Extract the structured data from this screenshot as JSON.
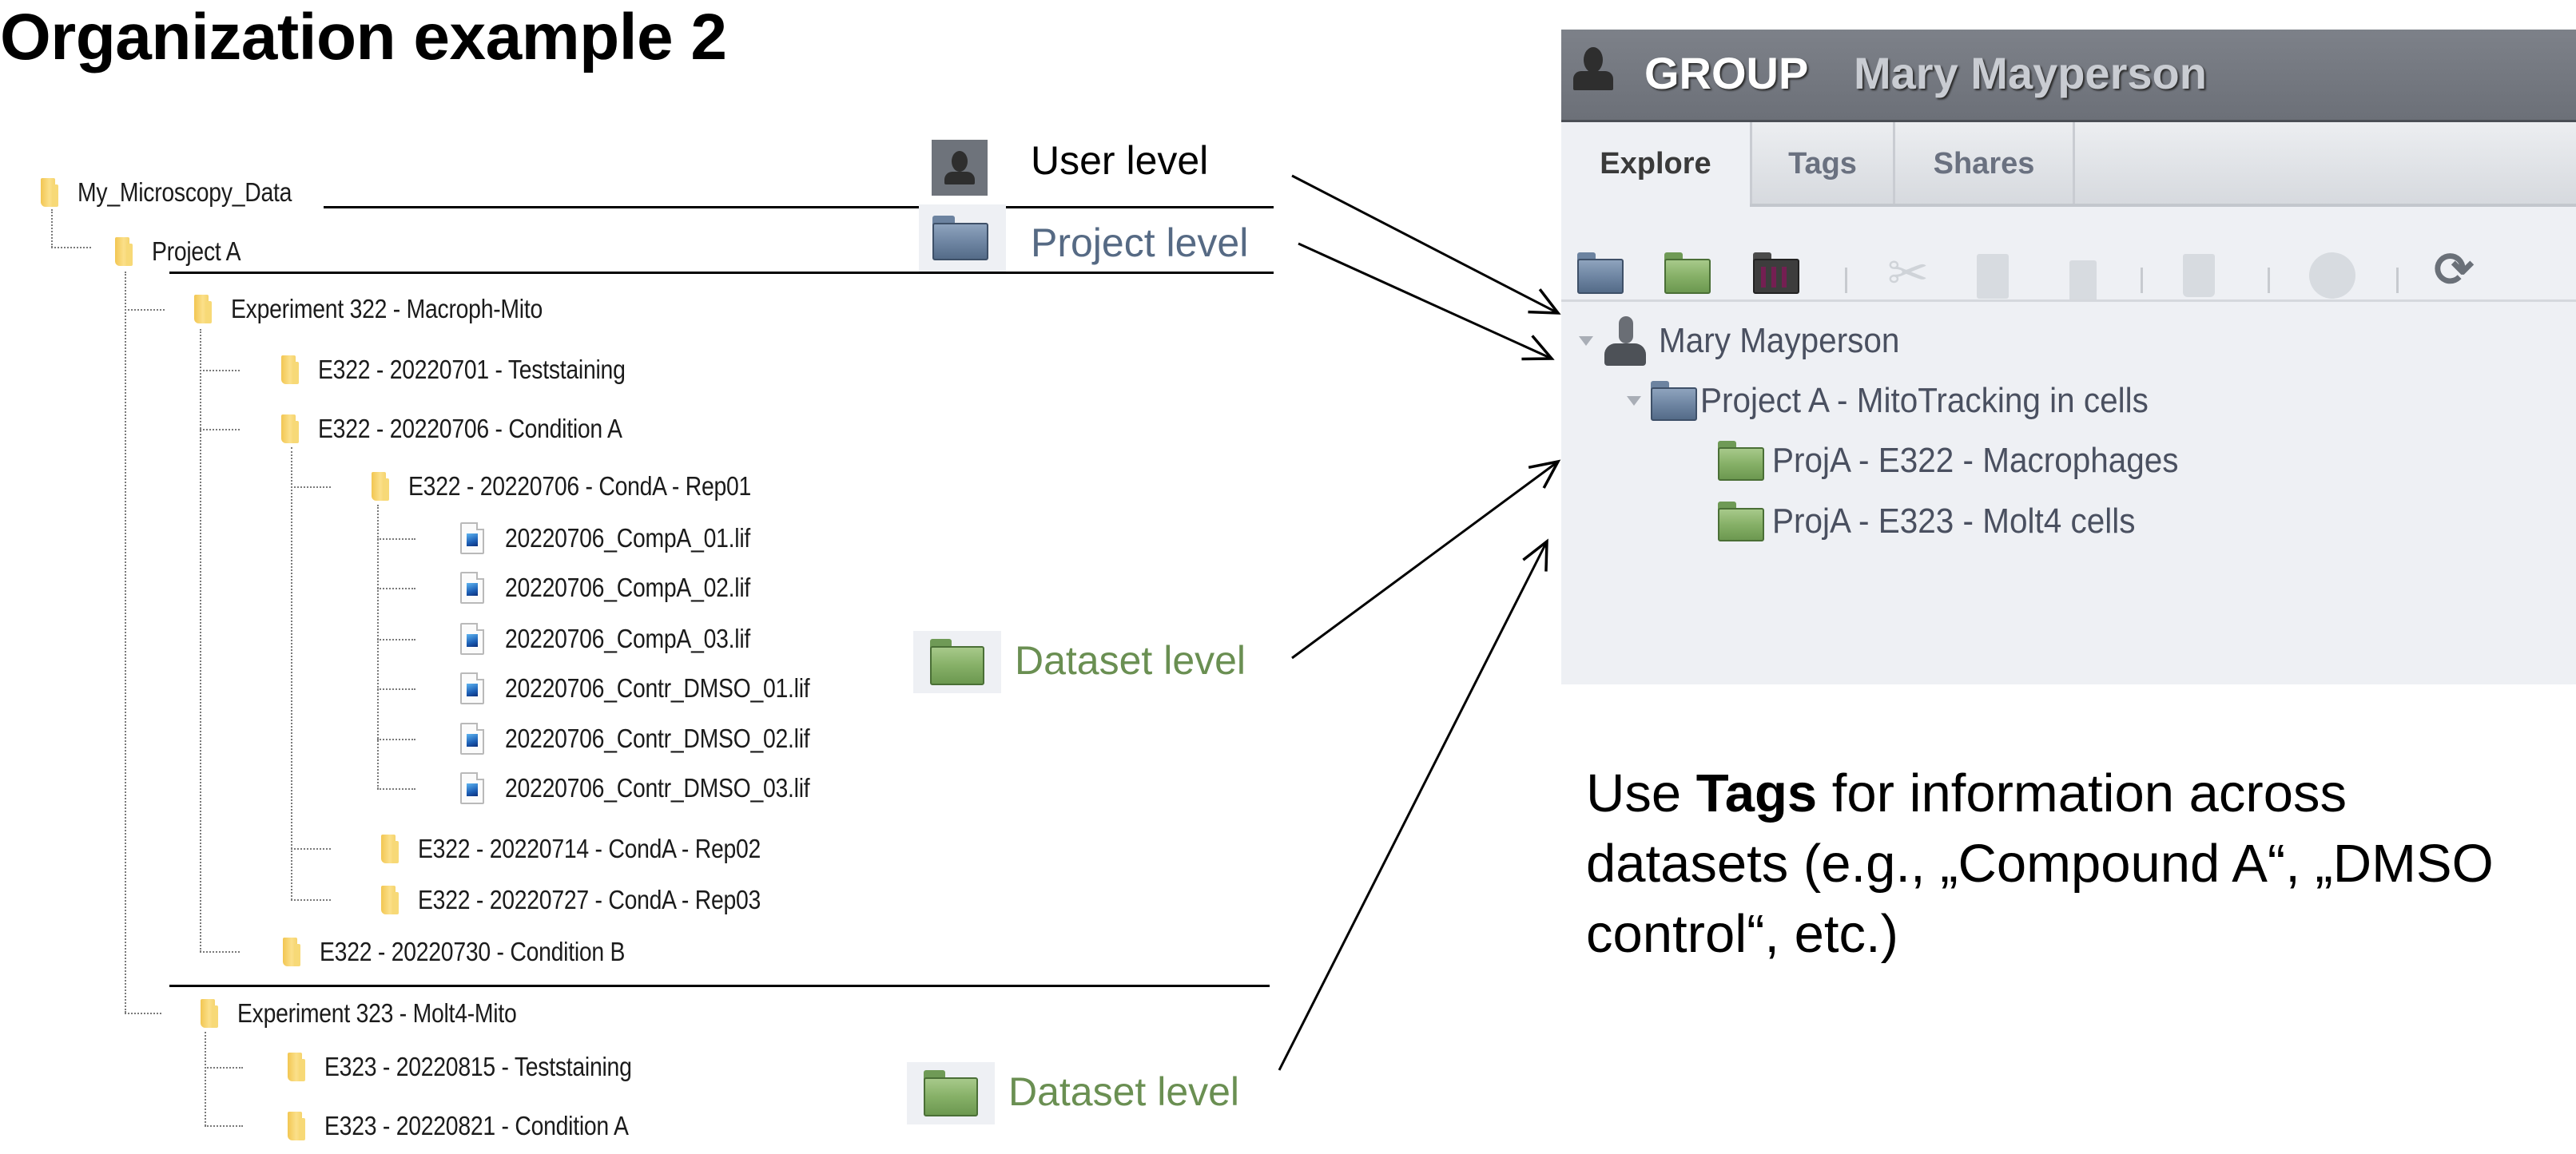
{
  "title": "Organization example 2",
  "file_tree": {
    "root": "My_Microscopy_Data",
    "project": "Project A",
    "experiments": [
      {
        "name": "Experiment 322 - Macroph-Mito",
        "children": [
          "E322 - 20220701 - Teststaining",
          "E322 - 20220706 - Condition A",
          "E322 - 20220706 - CondA - Rep01",
          "E322 - 20220714 - CondA - Rep02",
          "E322 - 20220727 - CondA - Rep03",
          "E322 - 20220730 - Condition B"
        ],
        "files": [
          "20220706_CompA_01.lif",
          "20220706_CompA_02.lif",
          "20220706_CompA_03.lif",
          "20220706_Contr_DMSO_01.lif",
          "20220706_Contr_DMSO_02.lif",
          "20220706_Contr_DMSO_03.lif"
        ]
      },
      {
        "name": "Experiment 323 - Molt4-Mito",
        "children": [
          "E323 - 20220815 - Teststaining",
          "E323 - 20220821 - Condition A"
        ]
      }
    ]
  },
  "levels": {
    "user": {
      "label": "User level",
      "color": "#000000"
    },
    "project": {
      "label": "Project level",
      "color": "#566a84"
    },
    "dataset_1": {
      "label": "Dataset level",
      "color": "#6a8f52"
    },
    "dataset_2": {
      "label": "Dataset level",
      "color": "#6a8f52"
    }
  },
  "omero_panel": {
    "header": {
      "group_label": "GROUP",
      "user_name": "Mary Mayperson"
    },
    "tabs": [
      {
        "label": "Explore",
        "active": true
      },
      {
        "label": "Tags",
        "active": false
      },
      {
        "label": "Shares",
        "active": false
      }
    ],
    "toolbar": {
      "buttons": [
        "new-project-icon",
        "new-dataset-icon",
        "new-screen-icon",
        "cut-icon",
        "copy-icon",
        "paste-icon",
        "delete-icon",
        "share-icon",
        "refresh-icon"
      ]
    },
    "tree": {
      "user": "Mary Mayperson",
      "project": "Project A - MitoTracking in cells",
      "datasets": [
        "ProjA - E322 - Macrophages",
        "ProjA - E323 - Molt4 cells"
      ]
    }
  },
  "note": {
    "prefix": "Use ",
    "bold": "Tags",
    "suffix": " for information across datasets (e.g., „Compound A“, „DMSO control“, etc.)"
  },
  "colors": {
    "panel_bg": "#eef0f4",
    "header_bg": "#70747c",
    "project_blue": "#6f86a3",
    "dataset_green": "#86b067"
  }
}
